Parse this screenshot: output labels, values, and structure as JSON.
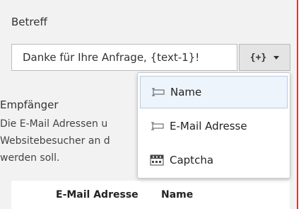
{
  "subject": {
    "label": "Betreff",
    "value": "Danke für Ihre Anfrage,  {text-1}!",
    "insert_button_label": "{+}"
  },
  "recipients": {
    "label": "Empfänger",
    "description_lines": [
      "Die E-Mail Adressen u",
      "Websitebesucher an d",
      "werden soll."
    ]
  },
  "table": {
    "headers": [
      "E-Mail Adresse",
      "Name"
    ]
  },
  "dropdown": {
    "items": [
      {
        "label": "Name",
        "icon": "text-field-icon",
        "active": true
      },
      {
        "label": "E-Mail Adresse",
        "icon": "text-field-icon",
        "active": false
      },
      {
        "label": "Captcha",
        "icon": "captcha-icon",
        "active": false
      }
    ]
  },
  "colors": {
    "accent_border": "#c83c3c",
    "dropdown_highlight": "#eef4fb"
  }
}
